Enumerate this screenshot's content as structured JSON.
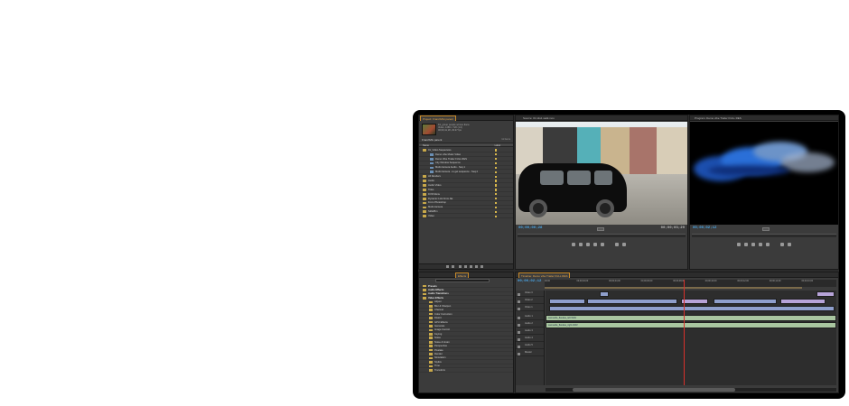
{
  "project_panel": {
    "tab_label": "Project: FranziMixi parent",
    "info_line1": "Kit_group people across Ikura",
    "info_line2": "Video, 1280 x 720 (1.0)",
    "info_line3": "00;00;41;28, 29.97 fps",
    "project_name": "FranziMix parent",
    "item_count": "11 Items",
    "columns": [
      "Name",
      "Label"
    ],
    "items": [
      {
        "label": "01_Video Sequences",
        "kind": "folder",
        "indent": 0
      },
      {
        "label": "Demo vibe Music Video",
        "kind": "seq",
        "indent": 1
      },
      {
        "label": "Demo Vibe Trailer FULL RES",
        "kind": "seq",
        "indent": 1
      },
      {
        "label": "City Window Sequence",
        "kind": "seq",
        "indent": 1
      },
      {
        "label": "Multi-Camera Audio - Seq 1",
        "kind": "seq",
        "indent": 1
      },
      {
        "label": "Multi-Camera - to get sequence - Seq 2",
        "kind": "seq",
        "indent": 1
      },
      {
        "label": "All Renders",
        "kind": "folder",
        "indent": 0
      },
      {
        "label": "Audio",
        "kind": "folder",
        "indent": 0
      },
      {
        "label": "Audio Video",
        "kind": "folder",
        "indent": 0
      },
      {
        "label": "Titles",
        "kind": "folder",
        "indent": 0
      },
      {
        "label": "DVD Menu",
        "kind": "folder",
        "indent": 0
      },
      {
        "label": "Dynamic Link From AE",
        "kind": "folder",
        "indent": 0
      },
      {
        "label": "From Photoshop",
        "kind": "folder",
        "indent": 0
      },
      {
        "label": "Multi-Camera",
        "kind": "folder",
        "indent": 0
      },
      {
        "label": "Stills/Bm",
        "kind": "folder",
        "indent": 0
      },
      {
        "label": "Video",
        "kind": "folder",
        "indent": 0
      }
    ]
  },
  "effects_panel": {
    "tab_label": "Effects",
    "items": [
      {
        "label": "Presets",
        "top": true,
        "indent": 0
      },
      {
        "label": "Audio Effects",
        "top": true,
        "indent": 0
      },
      {
        "label": "Audio Transitions",
        "top": true,
        "indent": 0
      },
      {
        "label": "Video Effects",
        "top": true,
        "indent": 0
      },
      {
        "label": "Adjust",
        "top": false,
        "indent": 1
      },
      {
        "label": "Blur & Sharpen",
        "top": false,
        "indent": 1
      },
      {
        "label": "Channel",
        "top": false,
        "indent": 1
      },
      {
        "label": "Color Correction",
        "top": false,
        "indent": 1
      },
      {
        "label": "Distort",
        "top": false,
        "indent": 1
      },
      {
        "label": "GPU Effects",
        "top": false,
        "indent": 1
      },
      {
        "label": "Generate",
        "top": false,
        "indent": 1
      },
      {
        "label": "Image Control",
        "top": false,
        "indent": 1
      },
      {
        "label": "Keying",
        "top": false,
        "indent": 1
      },
      {
        "label": "Noise",
        "top": false,
        "indent": 1
      },
      {
        "label": "Noise & Grain",
        "top": false,
        "indent": 1
      },
      {
        "label": "Perspective",
        "top": false,
        "indent": 1
      },
      {
        "label": "Pixelate",
        "top": false,
        "indent": 1
      },
      {
        "label": "Render",
        "top": false,
        "indent": 1
      },
      {
        "label": "Simulation",
        "top": false,
        "indent": 1
      },
      {
        "label": "Stylize",
        "top": false,
        "indent": 1
      },
      {
        "label": "Time",
        "top": false,
        "indent": 1
      },
      {
        "label": "Transform",
        "top": false,
        "indent": 1
      }
    ]
  },
  "source_monitor": {
    "tab_label": "Source: 01 kits1 walk.mov",
    "timecode_in": "00;00;00;28",
    "timecode_out": "00;00;03;29"
  },
  "program_monitor": {
    "tab_label": "Program: Demo vibe Trailer FULL RES",
    "timecode": "00;00;02;12"
  },
  "timeline": {
    "tab_label": "Timeline: Demo vibe Trailer FULL RES",
    "timecode": "00;00;02;12",
    "ruler_ticks": [
      "00;00",
      "00;00;02;00",
      "00;00;04;00",
      "00;00;06;00",
      "00;00;08;00",
      "00;00;10;00",
      "00;00;12;00",
      "00;00;14;00",
      "00;00;16;00"
    ],
    "tracks": [
      "Video 3",
      "Video 2",
      "Video 1",
      "Audio 1",
      "Audio 2",
      "Audio 3",
      "Audio 4",
      "Audio 5",
      "Master"
    ],
    "audio_clip_labels": [
      "samuelle_flavkas_left.WAV",
      "samuelle_flavkas_right.WAV"
    ]
  },
  "colors": {
    "accent_tab": "#e3a64d",
    "timecode_blue": "#4aa7e8",
    "playhead_red": "#d8302b",
    "video_clip": "#8f9fcc",
    "audio_clip": "#a9c6a0"
  }
}
